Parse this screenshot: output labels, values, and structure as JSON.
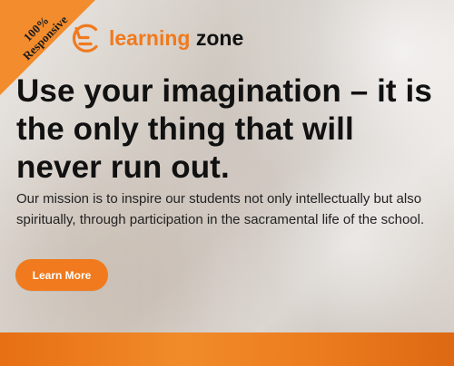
{
  "badge": {
    "line1": "100%",
    "line2": "Responsive"
  },
  "brand": {
    "primary": "learning",
    "secondary": "zone",
    "icon": "learning-zone-logo-icon"
  },
  "hero": {
    "title": "Use your imagination – it is the only thing that will never run out.",
    "description": "Our mission is to inspire our students not only intellectually but also spiritually, through participation in the sacramental life of the school."
  },
  "actions": {
    "learn_more": "Learn More"
  },
  "colors": {
    "accent": "#f07a1d",
    "heading": "#111111",
    "body": "#222222"
  }
}
